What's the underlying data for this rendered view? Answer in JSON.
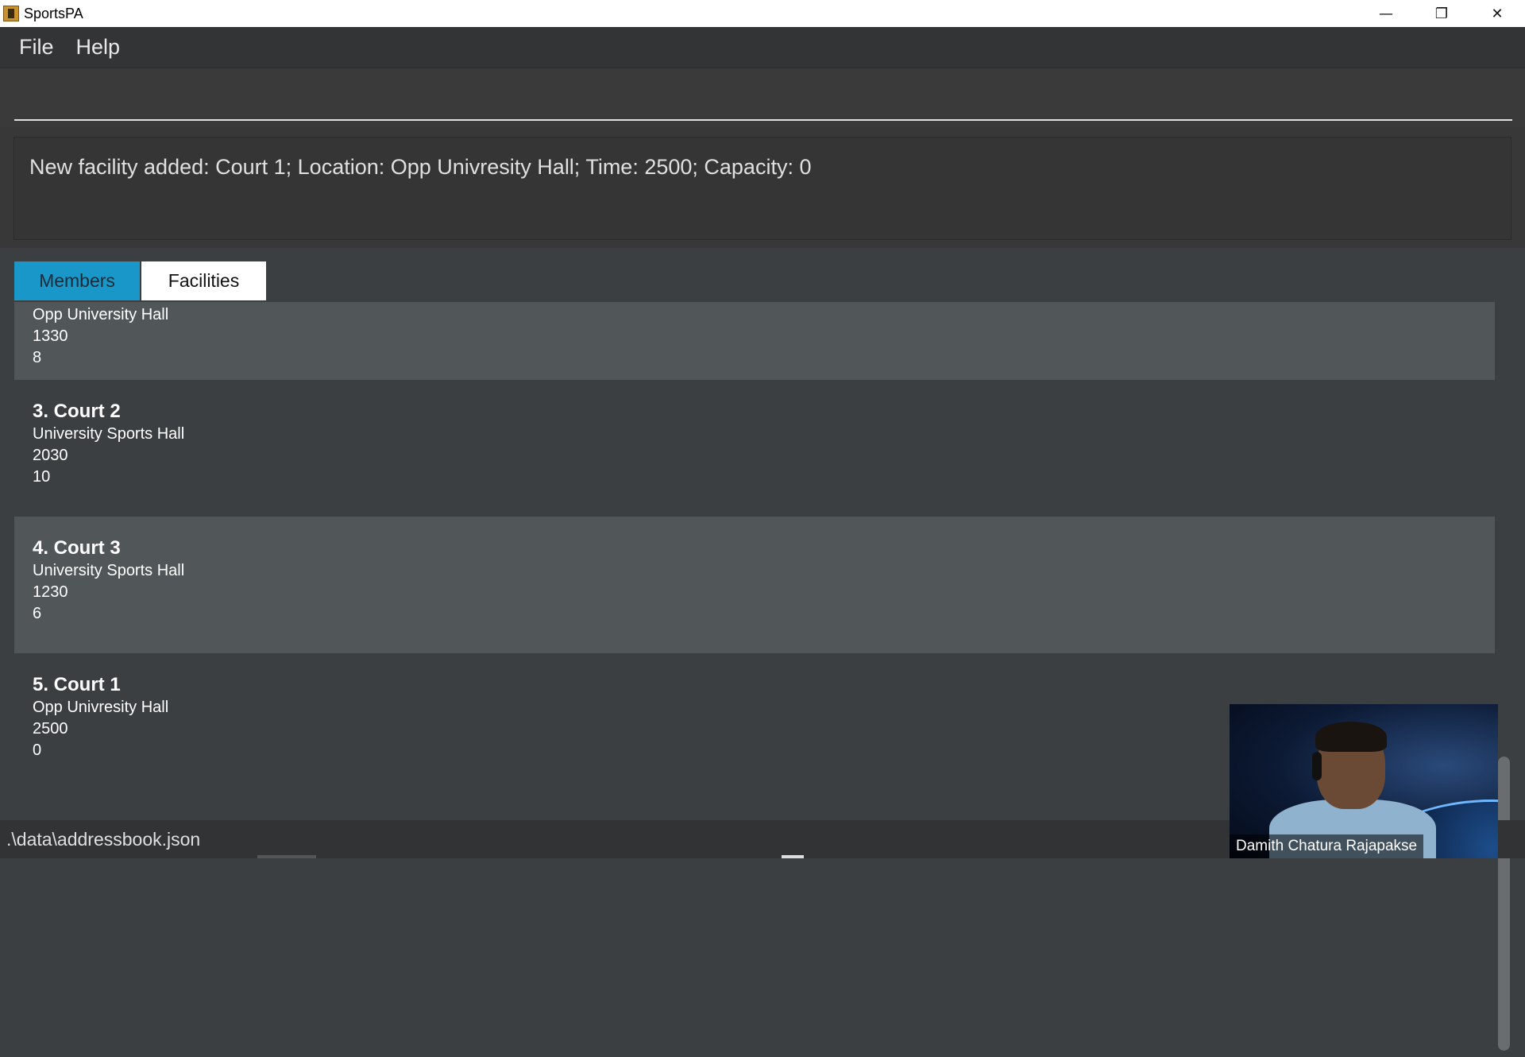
{
  "window": {
    "title": "SportsPA",
    "controls": {
      "minimize": "—",
      "restore": "❐",
      "close": "✕"
    }
  },
  "menu": {
    "items": [
      "File",
      "Help"
    ]
  },
  "command": {
    "value": "",
    "placeholder": ""
  },
  "result": {
    "text": "New facility added: Court 1; Location: Opp Univresity Hall; Time: 2500; Capacity: 0"
  },
  "tabs": [
    {
      "label": "Members",
      "selected": true,
      "color": "#1a97c9"
    },
    {
      "label": "Facilities",
      "selected": false,
      "color": "#ffffff"
    }
  ],
  "facilities": [
    {
      "name": "",
      "location": "Opp University Hall",
      "time": "1330",
      "capacity": "8"
    },
    {
      "name": "3. Court 2",
      "location": "University Sports Hall",
      "time": "2030",
      "capacity": "10"
    },
    {
      "name": "4. Court 3",
      "location": "University Sports Hall",
      "time": "1230",
      "capacity": "6"
    },
    {
      "name": "5. Court 1",
      "location": "Opp Univresity Hall",
      "time": "2500",
      "capacity": "0"
    }
  ],
  "status": {
    "path": ".\\data\\addressbook.json"
  },
  "video": {
    "participant": "Damith Chatura Rajapakse"
  },
  "icons": {
    "app": "sportspa-app-icon",
    "minimize": "minimize-icon",
    "restore": "restore-icon",
    "close": "close-icon"
  }
}
